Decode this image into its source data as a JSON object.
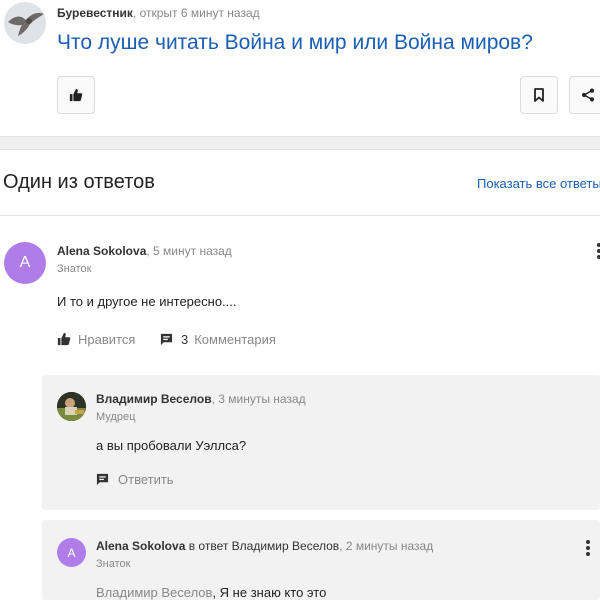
{
  "question": {
    "author": "Буревестник",
    "meta": ", открыт 6 минут назад",
    "title": "Что луше читать Война и мир или Война миров?"
  },
  "answers_section": {
    "heading": "Один из ответов",
    "show_all": "Показать все ответы"
  },
  "answer": {
    "avatar_letter": "A",
    "author": "Alena Sokolova",
    "meta": ", 5 минут назад",
    "rank": "Знаток",
    "text": "И то и другое не интересно....",
    "like_label": "Нравится",
    "comments_count": "3",
    "comments_label": "Комментария"
  },
  "comments": [
    {
      "author": "Владимир Веселов",
      "meta": ", 3 минуты назад",
      "rank": "Мудрец",
      "text": "а вы пробовали Уэллса?",
      "reply_label": "Ответить"
    },
    {
      "avatar_letter": "A",
      "author": "Alena Sokolova",
      "reply_prefix": " в ответ ",
      "reply_to": "Владимир Веселов",
      "meta": ", 2 минуты назад",
      "rank": "Знаток",
      "text_mention": "Владимир Веселов",
      "text": ", Я не знаю кто это"
    }
  ],
  "colors": {
    "link": "#1a5fb4",
    "avatar": "#b07de8",
    "comment_bg": "#f2f2f2"
  }
}
